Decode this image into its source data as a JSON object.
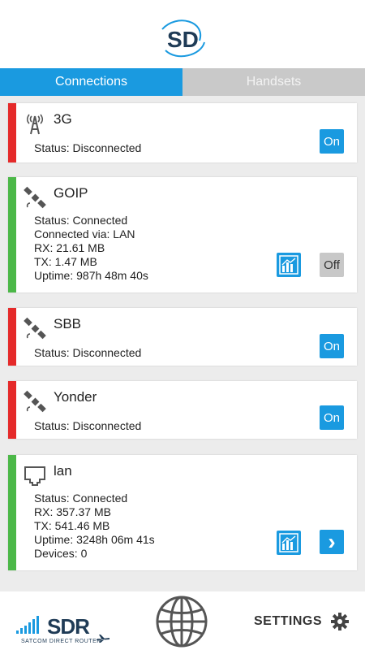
{
  "tabs": [
    {
      "label": "Connections",
      "active": true
    },
    {
      "label": "Handsets",
      "active": false
    }
  ],
  "colors": {
    "accent": "#1a9ae0",
    "connected": "#4cb848",
    "disconnected": "#e52a2a"
  },
  "connections": [
    {
      "name": "3G",
      "icon": "cell-tower-icon",
      "status_line": "Status: Disconnected",
      "toggle": "On"
    },
    {
      "name": "GOIP",
      "icon": "satellite-icon",
      "lines": [
        "Status: Connected",
        "Connected via: LAN",
        "RX: 21.61 MB",
        "TX: 1.47 MB",
        "Uptime: 987h 48m 40s"
      ],
      "toggle": "Off"
    },
    {
      "name": "SBB",
      "icon": "satellite-icon",
      "status_line": "Status: Disconnected",
      "toggle": "On"
    },
    {
      "name": "Yonder",
      "icon": "satellite-icon",
      "status_line": "Status: Disconnected",
      "toggle": "On"
    },
    {
      "name": "lan",
      "icon": "ethernet-port-icon",
      "lines": [
        "Status: Connected",
        "RX: 357.37 MB",
        "TX: 541.46 MB",
        "Uptime: 3248h 06m 41s",
        "Devices: 0"
      ],
      "next": "›"
    }
  ],
  "footer": {
    "brand": "SDR",
    "brand_sub": "SATCOM DIRECT ROUTER",
    "settings_label": "SETTINGS"
  }
}
